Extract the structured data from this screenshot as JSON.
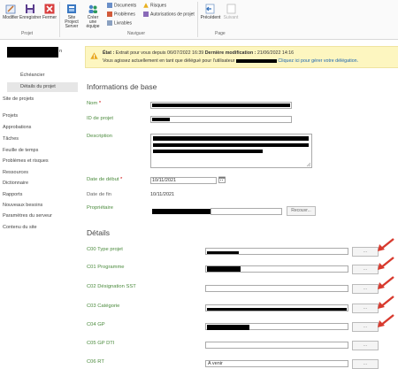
{
  "ribbon": {
    "project_group": "Projet",
    "navigate_group": "Naviguer",
    "page_group": "Page",
    "modifier": "Modifier",
    "enregistrer": "Enregistrer",
    "fermer": "Fermer",
    "site_project_server": "Site Project Server",
    "creer_equipe": "Créer une équipe",
    "documents": "Documents",
    "problemes": "Problèmes",
    "livrables": "Livrables",
    "risques": "Risques",
    "autorisations": "Autorisations de projet",
    "precedent": "Précédent",
    "suivant": "Suivant"
  },
  "warning": {
    "line1_bold1": "État :",
    "line1_text1": " Extrait pour vous depuis 06/07/2022 16:39 ",
    "line1_bold2": "Dernière modification :",
    "line1_text2": " 21/06/2022 14:16",
    "line2_text": "Vous agissez actuellement en tant que délégué pour l'utilisateur ",
    "line2_link": "Cliquez ici pour gérer votre délégation."
  },
  "nav": {
    "site_title_suffix": "n",
    "echeancier": "Échéancier",
    "details": "Détails du projet",
    "site_projets": "Site de projets",
    "items": [
      "Projets",
      "Approbations",
      "Tâches",
      "Feuille de temps",
      "Problèmes et risques",
      "Ressources",
      "Dictionnaire",
      "Rapports",
      "Nouveaux besoins",
      "Paramètres du serveur",
      "Contenu du site"
    ]
  },
  "main": {
    "section_basic": "Informations de base",
    "nom_label": "Nom",
    "id_label": "ID de projet",
    "description_label": "Description",
    "date_debut_label": "Date de début",
    "date_debut_value": "10/11/2021",
    "date_fin_label": "Date de fin",
    "date_fin_value": "10/11/2021",
    "proprietaire_label": "Propriétaire",
    "recouvrir_button": "Recouvr...",
    "required_mark": "*",
    "section_details": "Détails",
    "details_fields": [
      {
        "label": "C00 Type projet",
        "value": ""
      },
      {
        "label": "C01 Programme",
        "value": ""
      },
      {
        "label": "C02 Désignation SST",
        "value": ""
      },
      {
        "label": "C03 Catégorie",
        "value": ""
      },
      {
        "label": "C04 GP",
        "value": ""
      },
      {
        "label": "C05 GP DTI",
        "value": ""
      },
      {
        "label": "C06 RT",
        "value": "A venir"
      }
    ],
    "lookup_button": "..."
  },
  "colors": {
    "label_green": "#4a8a3c",
    "arrow_red": "#d83a2e",
    "warning_bg": "#fdf6c0",
    "link_blue": "#1a64b0"
  }
}
